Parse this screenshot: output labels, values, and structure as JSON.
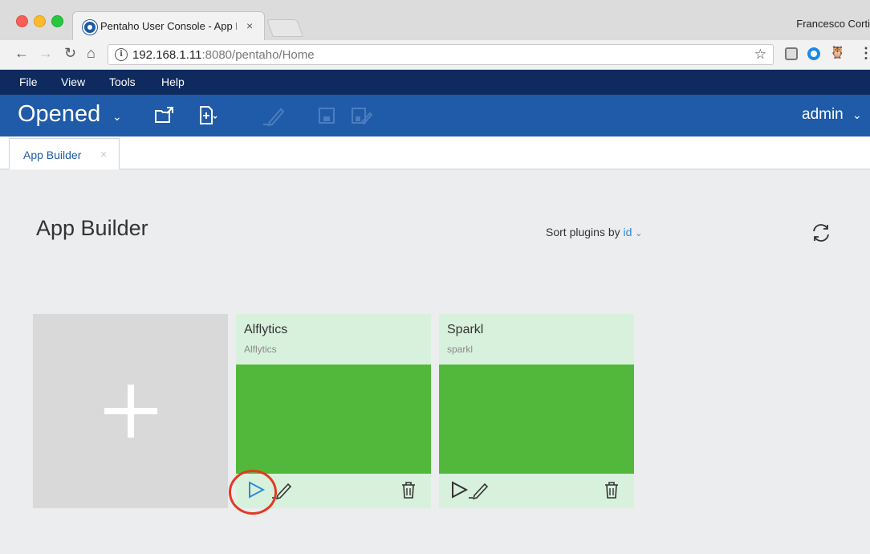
{
  "browser": {
    "tab_title": "Pentaho User Console - App B",
    "tab_close": "×",
    "profile": "Francesco Corti",
    "url_host": "192.168.1.11",
    "url_rest": ":8080/pentaho/Home",
    "star": "☆",
    "menu": "⋮"
  },
  "menubar": {
    "file": "File",
    "view": "View",
    "tools": "Tools",
    "help": "Help"
  },
  "appbar": {
    "perspective": "Opened",
    "user": "admin"
  },
  "doc_tabs": {
    "active_tab": "App Builder",
    "close": "×"
  },
  "page": {
    "title": "App Builder",
    "sort_label": "Sort plugins by",
    "sort_value": "id"
  },
  "plugins": [
    {
      "name": "Alflytics",
      "id": "Alflytics"
    },
    {
      "name": "Sparkl",
      "id": "sparkl"
    }
  ],
  "colors": {
    "menubar": "#0e2a5e",
    "appbar": "#1f5ba8",
    "card_bg": "#d8f1dc",
    "card_thumb": "#52b83b",
    "run_active": "#2e8bd6",
    "highlight": "#e23a22"
  }
}
